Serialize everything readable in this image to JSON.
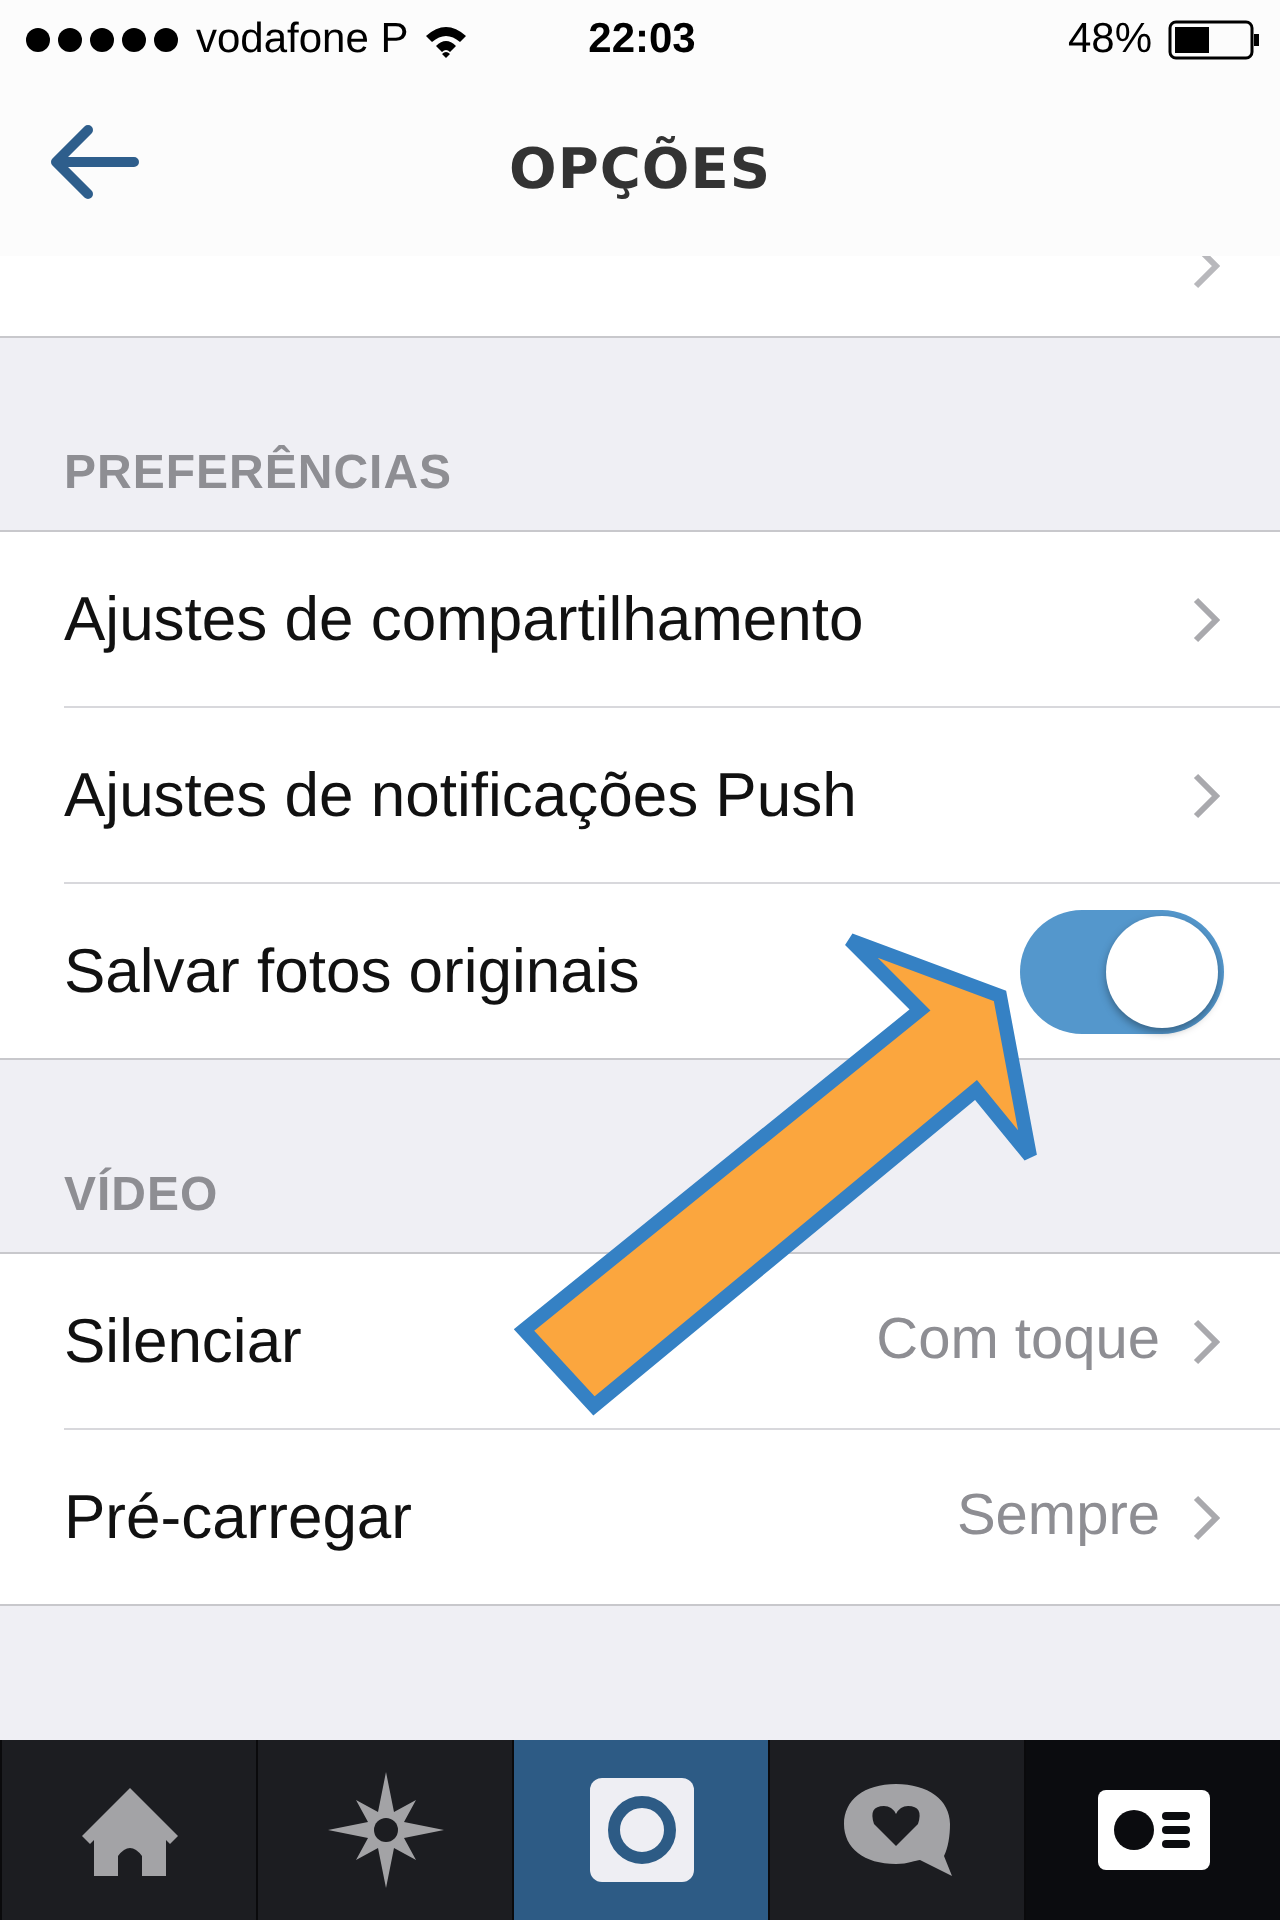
{
  "status_bar": {
    "carrier": "vodafone P",
    "time": "22:03",
    "battery": "48%"
  },
  "nav": {
    "title": "OPÇÕES"
  },
  "sections": [
    {
      "header": "PREFERÊNCIAS",
      "items": [
        {
          "kind": "link",
          "label": "Ajustes de compartilhamento"
        },
        {
          "kind": "link",
          "label": "Ajustes de notificações Push"
        },
        {
          "kind": "toggle",
          "label": "Salvar fotos originais",
          "on": true
        }
      ]
    },
    {
      "header": "VÍDEO",
      "items": [
        {
          "kind": "value",
          "label": "Silenciar",
          "value": "Com toque"
        },
        {
          "kind": "value",
          "label": "Pré-carregar",
          "value": "Sempre"
        }
      ]
    }
  ],
  "tab_bar": [
    {
      "kind": "home",
      "selected": false
    },
    {
      "kind": "explore",
      "selected": false
    },
    {
      "kind": "camera",
      "selected": true
    },
    {
      "kind": "activity",
      "selected": false
    },
    {
      "kind": "profile",
      "selected": false
    }
  ]
}
